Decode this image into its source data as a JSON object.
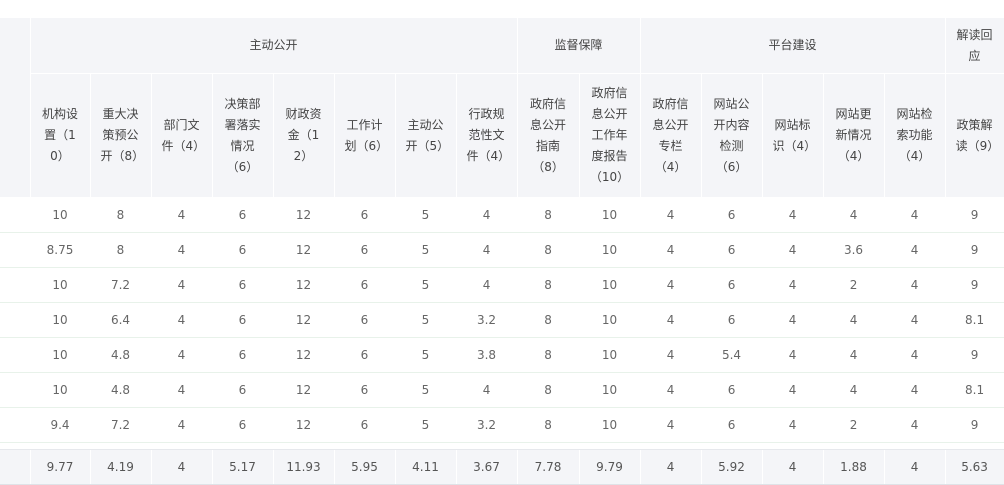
{
  "groups": [
    {
      "label": "主动公开"
    },
    {
      "label": "监督保障"
    },
    {
      "label": "平台建设"
    },
    {
      "label": "解读回应"
    }
  ],
  "columns": [
    {
      "label": "机构设置（10）"
    },
    {
      "label": "重大决策预公开（8）"
    },
    {
      "label": "部门文件（4）"
    },
    {
      "label": "决策部署落实情况（6）"
    },
    {
      "label": "财政资金（12）"
    },
    {
      "label": "工作计划（6）"
    },
    {
      "label": "主动公开（5）"
    },
    {
      "label": "行政规范性文件（4）"
    },
    {
      "label": "政府信息公开指南（8）"
    },
    {
      "label": "政府信息公开工作年度报告（10）"
    },
    {
      "label": "政府信息公开专栏（4）"
    },
    {
      "label": "网站公开内容检测（6）"
    },
    {
      "label": "网站标识（4）"
    },
    {
      "label": "网站更新情况（4）"
    },
    {
      "label": "网站检索功能（4）"
    },
    {
      "label": "政策解读（9）"
    }
  ],
  "rows": [
    [
      "10",
      "8",
      "4",
      "6",
      "12",
      "6",
      "5",
      "4",
      "8",
      "10",
      "4",
      "6",
      "4",
      "4",
      "4",
      "9"
    ],
    [
      "8.75",
      "8",
      "4",
      "6",
      "12",
      "6",
      "5",
      "4",
      "8",
      "10",
      "4",
      "6",
      "4",
      "3.6",
      "4",
      "9"
    ],
    [
      "10",
      "7.2",
      "4",
      "6",
      "12",
      "6",
      "5",
      "4",
      "8",
      "10",
      "4",
      "6",
      "4",
      "2",
      "4",
      "9"
    ],
    [
      "10",
      "6.4",
      "4",
      "6",
      "12",
      "6",
      "5",
      "3.2",
      "8",
      "10",
      "4",
      "6",
      "4",
      "4",
      "4",
      "8.1"
    ],
    [
      "10",
      "4.8",
      "4",
      "6",
      "12",
      "6",
      "5",
      "3.8",
      "8",
      "10",
      "4",
      "5.4",
      "4",
      "4",
      "4",
      "9"
    ],
    [
      "10",
      "4.8",
      "4",
      "6",
      "12",
      "6",
      "5",
      "4",
      "8",
      "10",
      "4",
      "6",
      "4",
      "4",
      "4",
      "8.1"
    ],
    [
      "9.4",
      "7.2",
      "4",
      "6",
      "12",
      "6",
      "5",
      "3.2",
      "8",
      "10",
      "4",
      "6",
      "4",
      "2",
      "4",
      "9"
    ]
  ],
  "average_row": [
    "9.77",
    "4.19",
    "4",
    "5.17",
    "11.93",
    "5.95",
    "4.11",
    "3.67",
    "7.78",
    "9.79",
    "4",
    "5.92",
    "4",
    "1.88",
    "4",
    "5.63"
  ]
}
